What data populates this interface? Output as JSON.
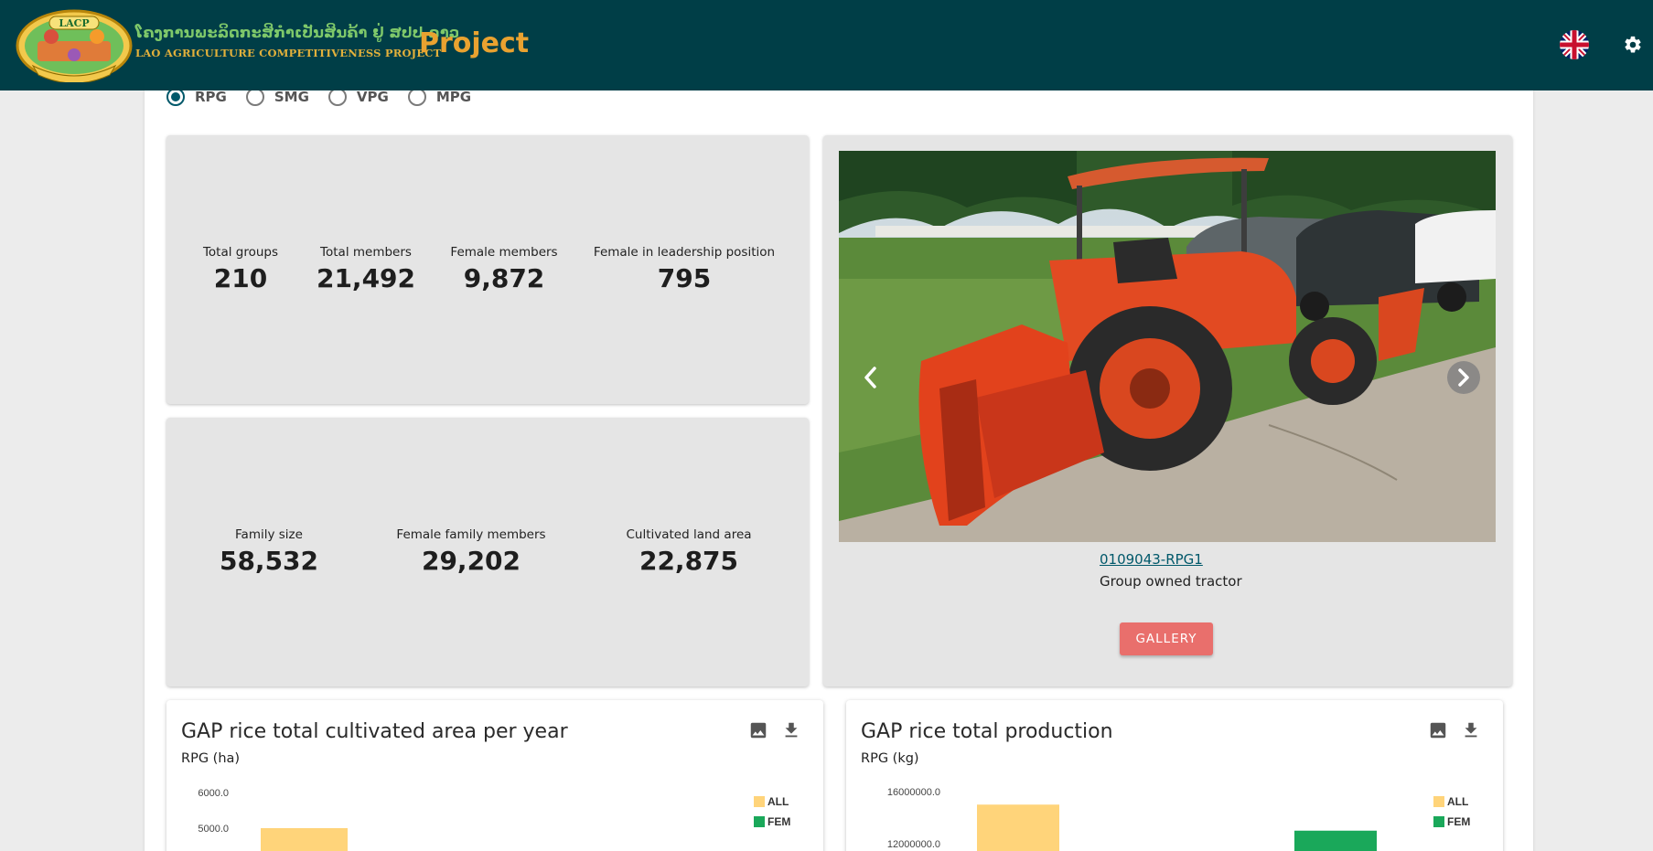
{
  "header": {
    "logo_lao_text": "ໂຄງການພະລິດກະສິກຳເປັນສິນຄ້າ ຢູ່ ສປປ ລາວ",
    "logo_en_text": "LAO AGRICULTURE COMPETITIVENESS PROJECT",
    "logo_badge": "LACP",
    "project_title": "Project",
    "language_icon": "uk-flag-icon",
    "settings_icon": "gear-icon"
  },
  "groups": {
    "options": [
      {
        "label": "RPG",
        "checked": true
      },
      {
        "label": "SMG",
        "checked": false
      },
      {
        "label": "VPG",
        "checked": false
      },
      {
        "label": "MPG",
        "checked": false
      }
    ]
  },
  "stats1": [
    {
      "label": "Total groups",
      "value": "210"
    },
    {
      "label": "Total members",
      "value": "21,492"
    },
    {
      "label": "Female members",
      "value": "9,872"
    },
    {
      "label": "Female in leadership position",
      "value": "795"
    }
  ],
  "stats2": [
    {
      "label": "Family size",
      "value": "58,532"
    },
    {
      "label": "Female family members",
      "value": "29,202"
    },
    {
      "label": "Cultivated land area",
      "value": "22,875"
    }
  ],
  "photo": {
    "code": "0109043-RPG1",
    "caption": "Group owned tractor",
    "gallery_label": "GALLERY",
    "prev_icon": "chevron-left-icon",
    "next_icon": "chevron-right-icon"
  },
  "colors": {
    "header_bg": "#003e47",
    "accent_orange": "#e9a230",
    "primary_teal": "#00586a",
    "gallery_red": "#e96f6c",
    "series_all": "#ffd47a",
    "series_fem": "#1aa85a"
  },
  "charts": [
    {
      "title": "GAP rice total cultivated area per year",
      "subtitle": "RPG (ha)"
    },
    {
      "title": "GAP rice total production",
      "subtitle": "RPG (kg)"
    }
  ],
  "chart_data": [
    {
      "type": "bar",
      "title": "GAP rice total cultivated area per year",
      "subtitle": "RPG (ha)",
      "ytick_labels": [
        "6000.0",
        "5000.0"
      ],
      "ylim": [
        0,
        6000
      ],
      "legend_position": "top-right",
      "series": [
        {
          "name": "ALL",
          "color": "#ffd47a",
          "visible_values": [
            5000
          ]
        },
        {
          "name": "FEM",
          "color": "#1aa85a",
          "visible_values": []
        }
      ]
    },
    {
      "type": "bar",
      "title": "GAP rice total production",
      "subtitle": "RPG (kg)",
      "ytick_labels": [
        "16000000.0",
        "12000000.0"
      ],
      "ylim": [
        0,
        16000000
      ],
      "legend_position": "top-right",
      "series": [
        {
          "name": "ALL",
          "color": "#ffd47a",
          "visible_values": [
            15000000
          ]
        },
        {
          "name": "FEM",
          "color": "#1aa85a",
          "visible_values": [
            13000000
          ]
        }
      ]
    }
  ]
}
